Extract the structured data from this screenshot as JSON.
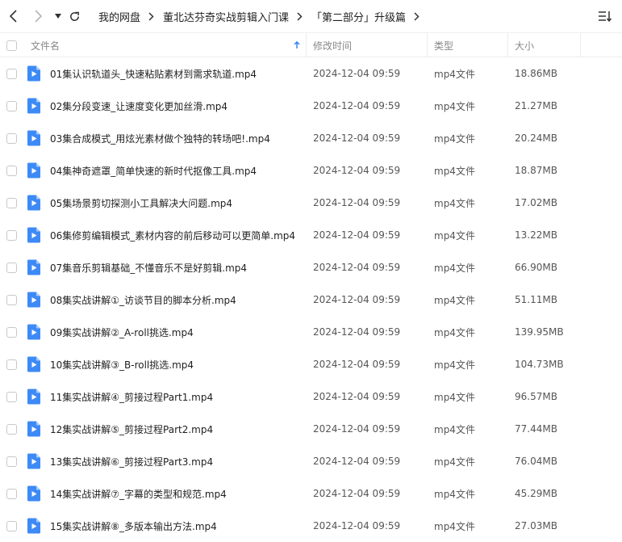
{
  "breadcrumb": [
    "我的网盘",
    "董北达芬奇实战剪辑入门课",
    "「第二部分」升级篇"
  ],
  "columns": {
    "name": "文件名",
    "modified": "修改时间",
    "type": "类型",
    "size": "大小"
  },
  "colors": {
    "file_icon": "#3d8af7",
    "sort_arrow": "#2b7bf0"
  },
  "files": [
    {
      "name": "01集认识轨道头_快速粘贴素材到需求轨道.mp4",
      "modified": "2024-12-04 09:59",
      "type": "mp4文件",
      "size": "18.86MB"
    },
    {
      "name": "02集分段变速_让速度变化更加丝滑.mp4",
      "modified": "2024-12-04 09:59",
      "type": "mp4文件",
      "size": "21.27MB"
    },
    {
      "name": "03集合成模式_用炫光素材做个独特的转场吧!.mp4",
      "modified": "2024-12-04 09:59",
      "type": "mp4文件",
      "size": "20.24MB"
    },
    {
      "name": "04集神奇遮罩_简单快速的新时代抠像工具.mp4",
      "modified": "2024-12-04 09:59",
      "type": "mp4文件",
      "size": "18.87MB"
    },
    {
      "name": "05集场景剪切探测小工具解决大问题.mp4",
      "modified": "2024-12-04 09:59",
      "type": "mp4文件",
      "size": "17.02MB"
    },
    {
      "name": "06集修剪编辑模式_素材内容的前后移动可以更简单.mp4",
      "modified": "2024-12-04 09:59",
      "type": "mp4文件",
      "size": "13.22MB"
    },
    {
      "name": "07集音乐剪辑基础_不懂音乐不是好剪辑.mp4",
      "modified": "2024-12-04 09:59",
      "type": "mp4文件",
      "size": "66.90MB"
    },
    {
      "name": "08集实战讲解①_访谈节目的脚本分析.mp4",
      "modified": "2024-12-04 09:59",
      "type": "mp4文件",
      "size": "51.11MB"
    },
    {
      "name": "09集实战讲解②_A-roll挑选.mp4",
      "modified": "2024-12-04 09:59",
      "type": "mp4文件",
      "size": "139.95MB"
    },
    {
      "name": "10集实战讲解③_B-roll挑选.mp4",
      "modified": "2024-12-04 09:59",
      "type": "mp4文件",
      "size": "104.73MB"
    },
    {
      "name": "11集实战讲解④_剪接过程Part1.mp4",
      "modified": "2024-12-04 09:59",
      "type": "mp4文件",
      "size": "96.57MB"
    },
    {
      "name": "12集实战讲解⑤_剪接过程Part2.mp4",
      "modified": "2024-12-04 09:59",
      "type": "mp4文件",
      "size": "77.44MB"
    },
    {
      "name": "13集实战讲解⑥_剪接过程Part3.mp4",
      "modified": "2024-12-04 09:59",
      "type": "mp4文件",
      "size": "76.04MB"
    },
    {
      "name": "14集实战讲解⑦_字幕的类型和规范.mp4",
      "modified": "2024-12-04 09:59",
      "type": "mp4文件",
      "size": "45.29MB"
    },
    {
      "name": "15集实战讲解⑧_多版本输出方法.mp4",
      "modified": "2024-12-04 09:59",
      "type": "mp4文件",
      "size": "27.03MB"
    }
  ]
}
